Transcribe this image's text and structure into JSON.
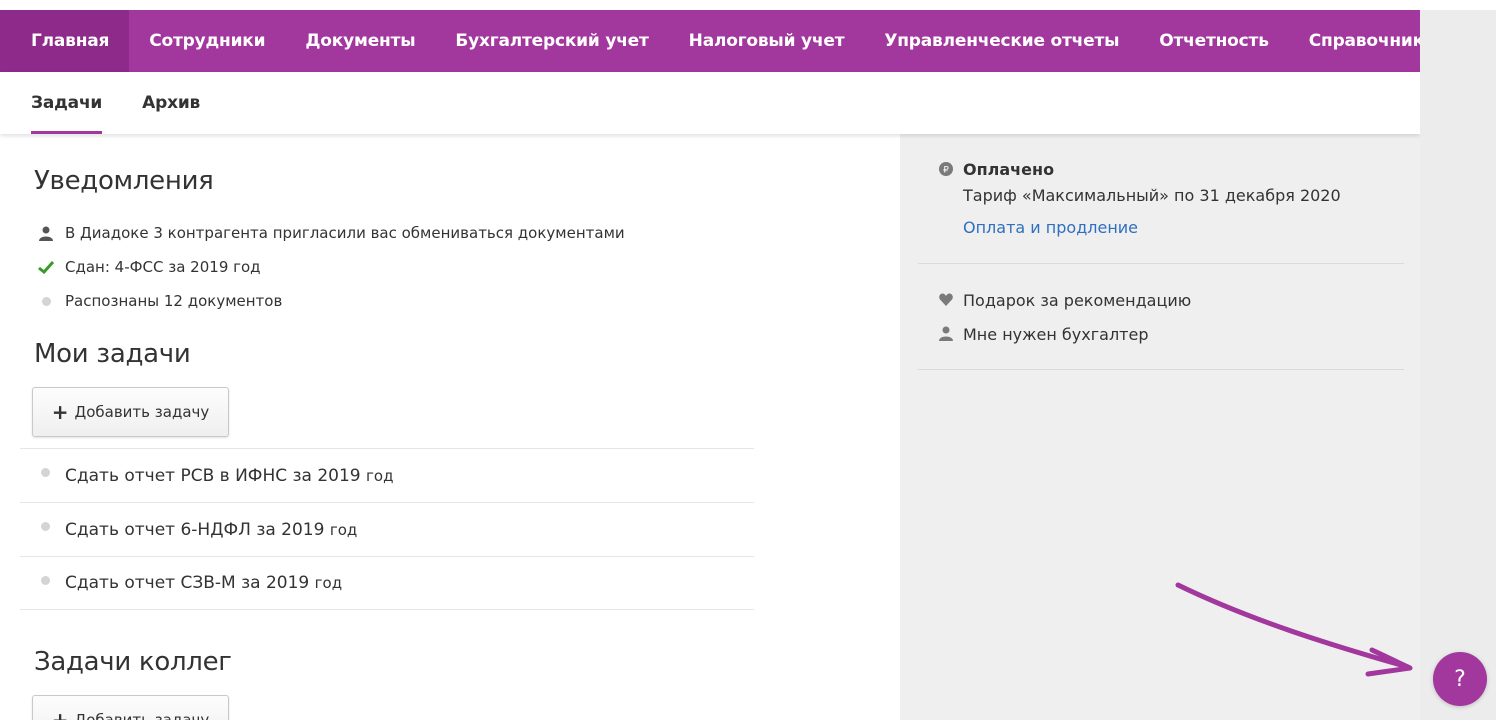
{
  "nav": {
    "items": [
      {
        "label": "Главная"
      },
      {
        "label": "Сотрудники"
      },
      {
        "label": "Документы"
      },
      {
        "label": "Бухгалтерский учет"
      },
      {
        "label": "Налоговый учет"
      },
      {
        "label": "Управленческие отчеты"
      },
      {
        "label": "Отчетность"
      },
      {
        "label": "Справочники"
      }
    ]
  },
  "subnav": {
    "tabs": [
      {
        "label": "Задачи"
      },
      {
        "label": "Архив"
      }
    ]
  },
  "notifications": {
    "title": "Уведомления",
    "items": [
      {
        "text": "В Диадоке 3 контрагента пригласили вас обмениваться документами",
        "icon": "person-icon"
      },
      {
        "text": "Сдан: 4-ФСС за 2019 год",
        "icon": "check-icon"
      },
      {
        "text": "Распознаны 12 документов",
        "icon": "dot-icon"
      }
    ]
  },
  "my_tasks": {
    "title": "Мои задачи",
    "add_button": "Добавить задачу",
    "items": [
      {
        "text": "Сдать отчет РСВ в ИФНС за 2019",
        "suffix": "год"
      },
      {
        "text": "Сдать отчет 6-НДФЛ за 2019",
        "suffix": "год"
      },
      {
        "text": "Сдать отчет СЗВ-М за 2019",
        "suffix": "год"
      }
    ]
  },
  "colleague_tasks": {
    "title": "Задачи коллег",
    "add_button": "Добавить задачу"
  },
  "sidebar": {
    "status": "Оплачено",
    "tariff": "Тариф «Максимальный» по 31 декабря 2020",
    "payment_link": "Оплата и продление",
    "gift": "Подарок за рекомендацию",
    "accountant": "Мне нужен бухгалтер"
  },
  "help": {
    "label": "?"
  },
  "colors": {
    "brand": "#a2379d",
    "brand_dark": "#8e2a89",
    "link": "#2f6fbf",
    "check": "#3a9a2a"
  }
}
